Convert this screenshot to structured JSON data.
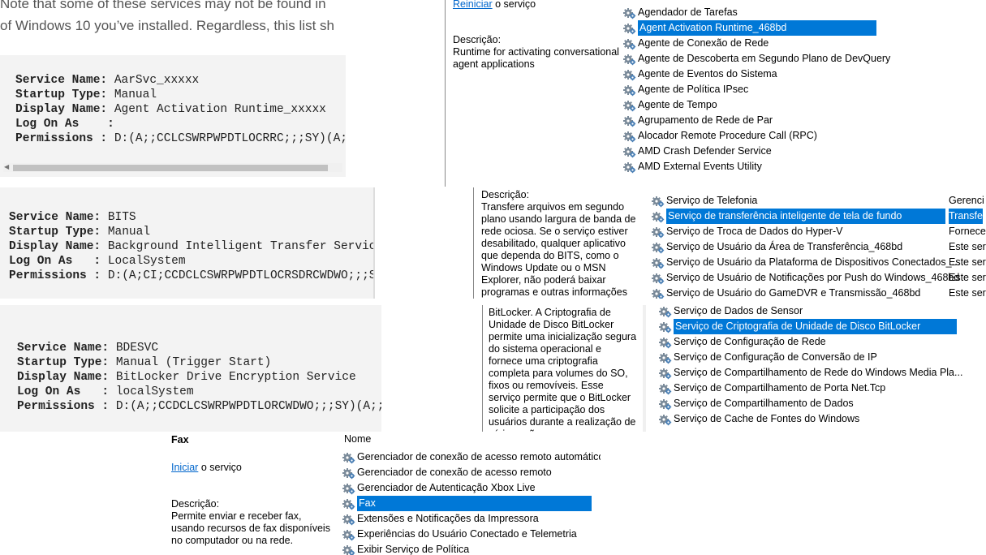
{
  "article": {
    "line1": "Note that some of these services may not be found in",
    "line2": "of Windows 10 you’ve installed. Regardless, this list sh"
  },
  "code_blocks": [
    {
      "lines": [
        {
          "label": "Service Name:",
          "value": " AarSvc_xxxxx"
        },
        {
          "label": "Startup Type:",
          "value": " Manual"
        },
        {
          "label": "Display Name:",
          "value": " Agent Activation Runtime_xxxxx"
        },
        {
          "label": "Log On As    :",
          "value": ""
        },
        {
          "label": "Permissions :",
          "value": " D:(A;;CCLCSWRPWPDTLOCRRC;;;SY)(A;;C"
        }
      ]
    },
    {
      "lines": [
        {
          "label": "Service Name:",
          "value": " BITS"
        },
        {
          "label": "Startup Type:",
          "value": " Manual"
        },
        {
          "label": "Display Name:",
          "value": " Background Intelligent Transfer Service"
        },
        {
          "label": "Log On As   :",
          "value": " LocalSystem"
        },
        {
          "label": "Permissions :",
          "value": " D:(A;CI;CCDCLCSWRPWPDTLOCRSDRCWDWO;;;SY)"
        }
      ]
    },
    {
      "lines": [
        {
          "label": "Service Name:",
          "value": " BDESVC"
        },
        {
          "label": "Startup Type:",
          "value": " Manual (Trigger Start)"
        },
        {
          "label": "Display Name:",
          "value": " BitLocker Drive Encryption Service"
        },
        {
          "label": "Log On As   :",
          "value": " localSystem"
        },
        {
          "label": "Permissions :",
          "value": " D:(A;;CCDCLCSWRPWPDTLORCWDWO;;;SY)(A;;CC"
        }
      ]
    }
  ],
  "panel1": {
    "restart_link": "Reiniciar",
    "restart_suffix": " o serviço",
    "desc_label": "Descrição:",
    "desc_text": "Runtime for activating conversational agent applications",
    "services": [
      "Agendador de Tarefas",
      "Agent Activation Runtime_468bd",
      "Agente de Conexão de Rede",
      "Agente de Descoberta em Segundo Plano de DevQuery",
      "Agente de Eventos do Sistema",
      "Agente de Política IPsec",
      "Agente de Tempo",
      "Agrupamento de Rede de Par",
      "Alocador Remote Procedure Call (RPC)",
      "AMD Crash Defender Service",
      "AMD External Events Utility"
    ],
    "selected_index": 1
  },
  "panel2": {
    "desc_label": "Descrição:",
    "desc_text": "Transfere arquivos em segundo plano usando largura de banda de rede ociosa. Se o serviço estiver desabilitado, qualquer aplicativo que dependa do BITS, como o Windows Update ou o MSN Explorer, não poderá baixar programas e outras informações automaticamente.",
    "services": [
      {
        "name": "Serviço de Telefonia",
        "desc": "Gerenci"
      },
      {
        "name": "Serviço de transferência inteligente de tela de fundo",
        "desc": "Transfe"
      },
      {
        "name": "Serviço de Troca de Dados do Hyper-V",
        "desc": "Fornece"
      },
      {
        "name": "Serviço de Usuário da Área de Transferência_468bd",
        "desc": "Este ser"
      },
      {
        "name": "Serviço de Usuário da Plataforma de Dispositivos Conectados_...",
        "desc": "Este ser"
      },
      {
        "name": "Serviço de Usuário de Notificações por Push do Windows_468bd",
        "desc": "Este ser"
      },
      {
        "name": "Serviço de Usuário do GameDVR e Transmissão_468bd",
        "desc": "Este ser"
      }
    ],
    "selected_index": 1
  },
  "panel3": {
    "desc_text": "BitLocker. A Criptografia de Unidade de Disco BitLocker permite uma inicialização segura do sistema operacional e fornece uma criptografia completa para volumes do SO, fixos ou removíveis. Esse serviço permite que o BitLocker solicite a participação dos usuários durante a realização de várias ações",
    "services": [
      "Serviço de Dados de Sensor",
      "Serviço de Criptografia de Unidade de Disco BitLocker",
      "Serviço de Configuração de Rede",
      "Serviço de Configuração de Conversão de IP",
      "Serviço de Compartilhamento de Rede do Windows Media Pla...",
      "Serviço de Compartilhamento de Porta Net.Tcp",
      "Serviço de Compartilhamento de Dados",
      "Serviço de Cache de Fontes do Windows"
    ],
    "selected_index": 1
  },
  "panel4": {
    "title": "Fax",
    "column_header": "Nome",
    "start_link": "Iniciar",
    "start_suffix": " o serviço",
    "desc_label": "Descrição:",
    "desc_text": "Permite enviar e receber fax, usando recursos de fax disponíveis no computador ou na rede.",
    "services": [
      "Gerenciador de conexão de acesso remoto automático",
      "Gerenciador de conexão de acesso remoto",
      "Gerenciador de Autenticação Xbox Live",
      "Fax",
      "Extensões e Notificações da Impressora",
      "Experiências do Usuário Conectado e Telemetria",
      "Exibir Serviço de Política"
    ],
    "selected_index": 3
  }
}
